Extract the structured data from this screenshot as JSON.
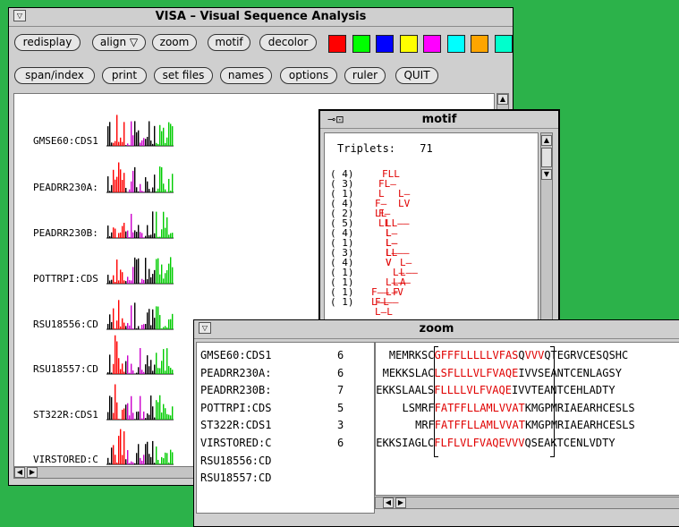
{
  "main_window": {
    "title": "VISA – Visual Sequence Analysis",
    "buttons_row1": [
      "redisplay",
      "align ▽",
      "zoom",
      "motif",
      "decolor"
    ],
    "buttons_row2": [
      "span/index",
      "print",
      "set files",
      "names",
      "options",
      "ruler",
      "QUIT"
    ],
    "color_swatches": [
      "#ff0000",
      "#00ff00",
      "#0000ff",
      "#ffff00",
      "#ff00ff",
      "#00ffff",
      "#ffa500",
      "#00ffcc"
    ],
    "sequence_labels": [
      "GMSE60:CDS1",
      "PEADRR230A:",
      "PEADRR230B:",
      "POTTRPI:CDS",
      "RSU18556:CD",
      "RSU18557:CD",
      "ST322R:CDS1",
      "VIRSTORED:C"
    ]
  },
  "motif_window": {
    "title": "motif",
    "triplets_label": "Triplets:",
    "triplets_value": "71",
    "rows": [
      {
        "count": "(  4)",
        "pattern": "FLL"
      },
      {
        "count": "(  3)",
        "pattern": "FL–L"
      },
      {
        "count": "(  1)",
        "pattern": "L–LV"
      },
      {
        "count": "(  4)",
        "pattern": "F–LL"
      },
      {
        "count": "(  2)",
        "pattern": "F–LL"
      },
      {
        "count": "(  5)",
        "pattern": "LL––L"
      },
      {
        "count": "(  4)",
        "pattern": "L–L–L"
      },
      {
        "count": "(  1)",
        "pattern": "L–L–V"
      },
      {
        "count": "(  3)",
        "pattern": "LL––V"
      },
      {
        "count": "(  4)",
        "pattern": "L–L––A"
      },
      {
        "count": "(  1)",
        "pattern": "L–L––F"
      },
      {
        "count": "(  1)",
        "pattern": "L––L–V"
      },
      {
        "count": "(  1)",
        "pattern": "F––L–L"
      },
      {
        "count": "(  1)",
        "pattern": "F–––L–L"
      }
    ]
  },
  "zoom_window": {
    "title": "zoom",
    "rows": [
      {
        "name": "GMSE60:CDS1",
        "num": "6",
        "pre": "MEMRKS",
        "mid_black": "C",
        "motif": "GFFFLLLLLVFAS",
        "post_black": "Q",
        "tail_red": "VVV",
        "rest": "QTEGRVCESQSHC"
      },
      {
        "name": "PEADRR230A:",
        "num": "6",
        "pre": "MEKKSLA",
        "mid_black": "C",
        "motif": "LSFLLLVLFVAQE",
        "post_black": "",
        "tail_red": "",
        "rest": "IVVSEANTCENLAGSY"
      },
      {
        "name": "PEADRR230B:",
        "num": "7",
        "pre": "MEKKSLAALS",
        "mid_black": "",
        "motif": "FLLLLVLFVAQE",
        "post_black": "",
        "tail_red": "",
        "rest": "IVVTEANTCEHLADTY"
      },
      {
        "name": "POTTRPI:CDS",
        "num": "5",
        "pre": "LSMRF",
        "mid_black": "",
        "motif": "FATFFLLAM",
        "post_black": "",
        "tail_red": "LVVAT",
        "rest": "KMGPMRIAEARHCESLS"
      },
      {
        "name": "ST322R:CDS1",
        "num": "3",
        "pre": "MRF",
        "mid_black": "",
        "motif": "FATFFLLAM",
        "post_black": "",
        "tail_red": "LVVAT",
        "rest": "KMGPMRIAEARHCESLS"
      },
      {
        "name": "VIRSTORED:C",
        "num": "6",
        "pre": "MEKKSI",
        "mid_black": "AGLC",
        "motif": "FLFLVLFVAQE",
        "post_black": "",
        "tail_red": "VVV",
        "rest": "QSEAKTCENLVDTY"
      },
      {
        "name": "RSU18556:CD",
        "num": "",
        "pre": "",
        "mid_black": "",
        "motif": "",
        "post_black": "",
        "tail_red": "",
        "rest": ""
      },
      {
        "name": "RSU18557:CD",
        "num": "",
        "pre": "",
        "mid_black": "",
        "motif": "",
        "post_black": "",
        "tail_red": "",
        "rest": ""
      }
    ]
  }
}
